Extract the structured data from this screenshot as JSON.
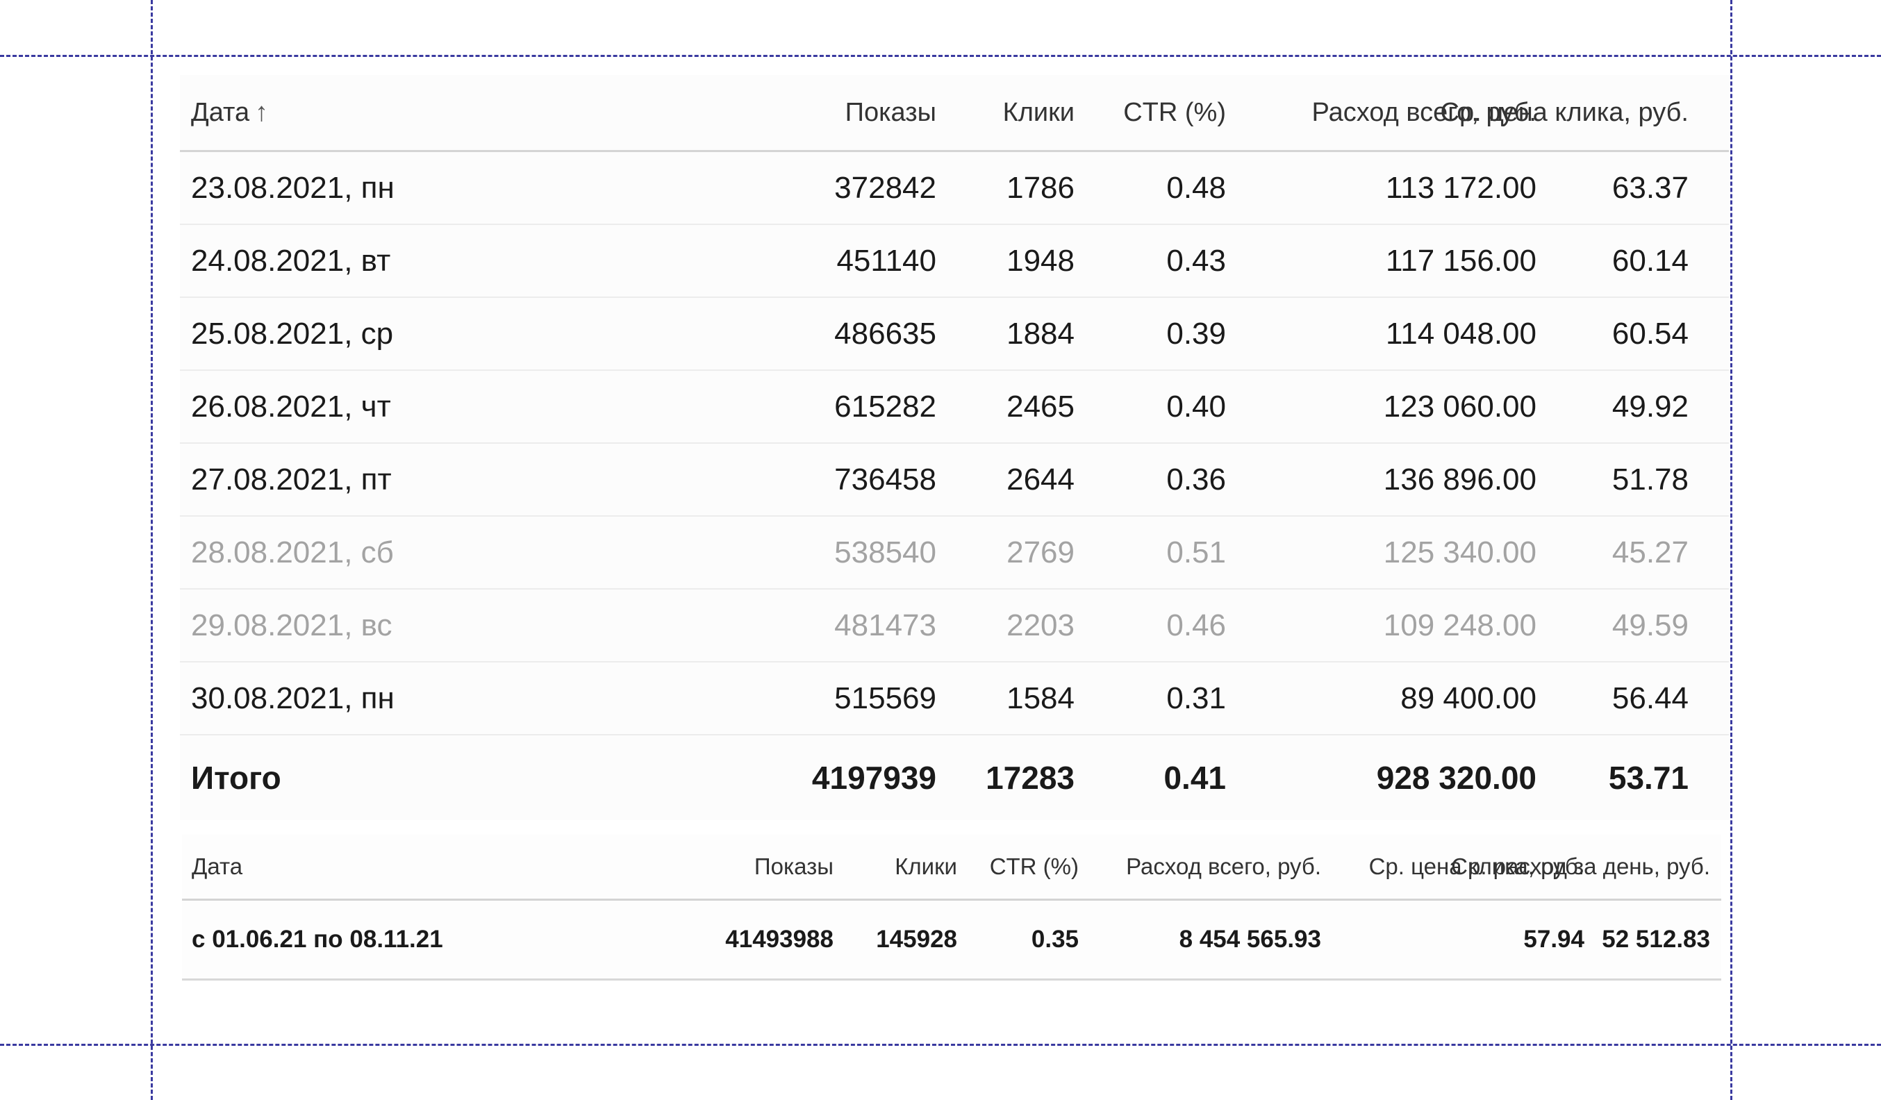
{
  "colors": {
    "guide": "#3a3aa0",
    "text": "#1a1a1a",
    "muted_text": "#a3a3a3"
  },
  "daily_table": {
    "headers": {
      "date": "Дата",
      "sort_icon": "↑",
      "shows": "Показы",
      "clicks": "Клики",
      "ctr": "CTR (%)",
      "spend": "Расход всего, руб.",
      "cpc": "Ср. цена клика, руб."
    },
    "rows": [
      {
        "date": "23.08.2021, пн",
        "shows": "372842",
        "clicks": "1786",
        "ctr": "0.48",
        "spend": "113 172.00",
        "cpc": "63.37",
        "weekend": false
      },
      {
        "date": "24.08.2021, вт",
        "shows": "451140",
        "clicks": "1948",
        "ctr": "0.43",
        "spend": "117 156.00",
        "cpc": "60.14",
        "weekend": false
      },
      {
        "date": "25.08.2021, ср",
        "shows": "486635",
        "clicks": "1884",
        "ctr": "0.39",
        "spend": "114 048.00",
        "cpc": "60.54",
        "weekend": false
      },
      {
        "date": "26.08.2021, чт",
        "shows": "615282",
        "clicks": "2465",
        "ctr": "0.40",
        "spend": "123 060.00",
        "cpc": "49.92",
        "weekend": false
      },
      {
        "date": "27.08.2021, пт",
        "shows": "736458",
        "clicks": "2644",
        "ctr": "0.36",
        "spend": "136 896.00",
        "cpc": "51.78",
        "weekend": false
      },
      {
        "date": "28.08.2021, сб",
        "shows": "538540",
        "clicks": "2769",
        "ctr": "0.51",
        "spend": "125 340.00",
        "cpc": "45.27",
        "weekend": true
      },
      {
        "date": "29.08.2021, вс",
        "shows": "481473",
        "clicks": "2203",
        "ctr": "0.46",
        "spend": "109 248.00",
        "cpc": "49.59",
        "weekend": true
      },
      {
        "date": "30.08.2021, пн",
        "shows": "515569",
        "clicks": "1584",
        "ctr": "0.31",
        "spend": "89 400.00",
        "cpc": "56.44",
        "weekend": false
      }
    ],
    "total": {
      "label": "Итого",
      "shows": "4197939",
      "clicks": "17283",
      "ctr": "0.41",
      "spend": "928 320.00",
      "cpc": "53.71"
    }
  },
  "period_table": {
    "headers": {
      "date": "Дата",
      "shows": "Показы",
      "clicks": "Клики",
      "ctr": "CTR (%)",
      "spend": "Расход всего, руб.",
      "cpc": "Ср. цена клика, руб.",
      "avg_day": "Ср. расход за день, руб."
    },
    "row": {
      "date": "с 01.06.21 по 08.11.21",
      "shows": "41493988",
      "clicks": "145928",
      "ctr": "0.35",
      "spend": "8 454 565.93",
      "cpc": "57.94",
      "avg_day": "52 512.83"
    }
  }
}
